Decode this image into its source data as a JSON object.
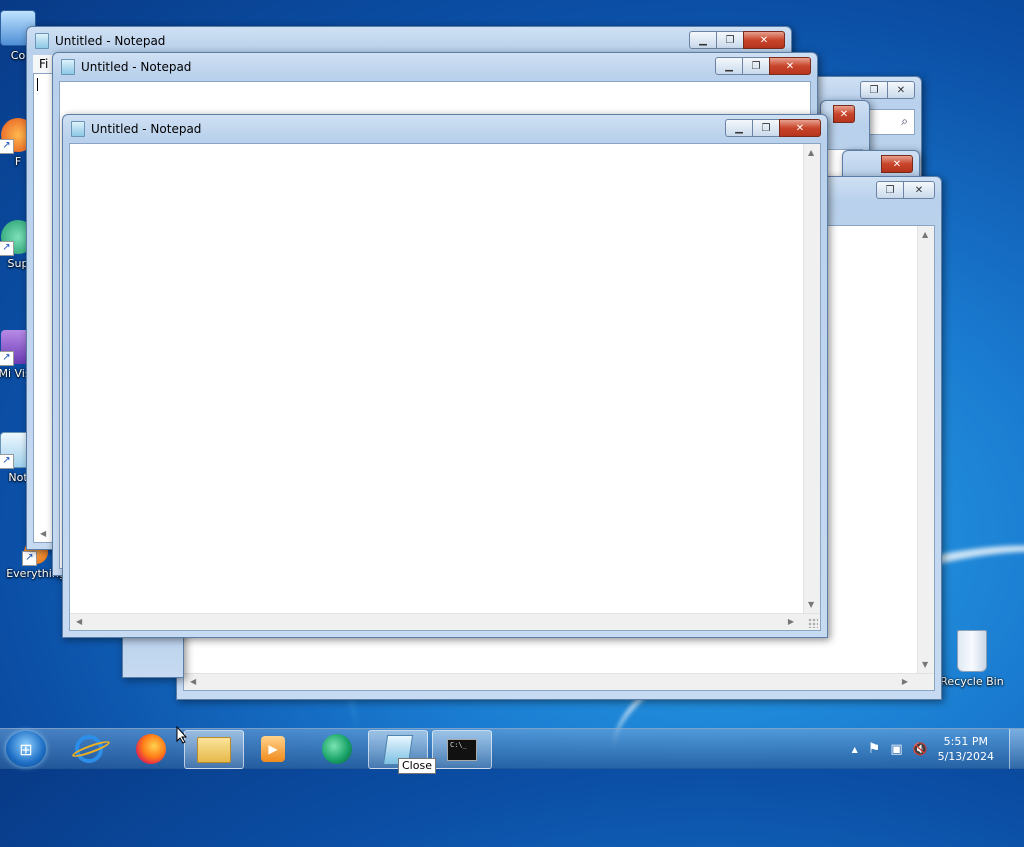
{
  "desktop": {
    "icons": [
      {
        "label": "Co",
        "name": "computer-icon"
      },
      {
        "label": "F",
        "name": "firefox-shortcut-icon"
      },
      {
        "label": "Sup",
        "name": "support-shortcut-icon"
      },
      {
        "label": "Mi Visu",
        "name": "visual-studio-shortcut-icon"
      },
      {
        "label": "Not",
        "name": "notepad-shortcut-icon"
      },
      {
        "label": "Everything",
        "name": "everything-shortcut-icon"
      },
      {
        "label": "Recycle Bin",
        "name": "recycle-bin-icon"
      }
    ]
  },
  "windows": {
    "back_notepad_1": {
      "title": "Untitled - Notepad",
      "menu_first": "Fi"
    },
    "back_notepad_2": {
      "title": "Untitled - Notepad"
    },
    "front_notepad": {
      "title": "Untitled - Notepad"
    }
  },
  "window_controls": {
    "minimize": "▁",
    "maximize": "❐",
    "close": "✕"
  },
  "taskbar": {
    "start_glyph": "⊞",
    "pinned": [
      {
        "name": "internet-explorer-icon"
      },
      {
        "name": "firefox-icon"
      },
      {
        "name": "file-explorer-icon"
      },
      {
        "name": "media-player-icon"
      },
      {
        "name": "edge-dev-icon"
      },
      {
        "name": "notepad-taskbar-icon"
      },
      {
        "name": "command-prompt-icon"
      }
    ],
    "cmd_text": "C:\\_",
    "tooltip": "Close",
    "tray": {
      "time": "5:51 PM",
      "date": "5/13/2024",
      "chevron": "▲",
      "flag": "⚑",
      "network": "▣",
      "volume": "🔇"
    }
  }
}
